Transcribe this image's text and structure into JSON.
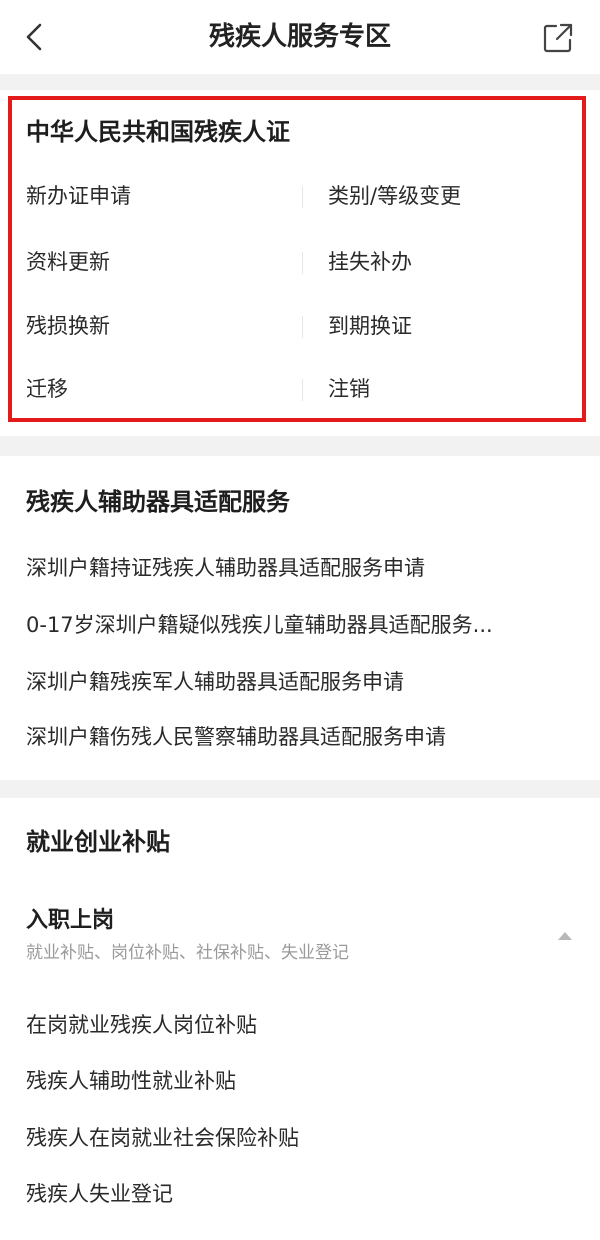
{
  "header": {
    "title": "残疾人服务专区",
    "back_icon": "back-chevron-icon",
    "share_icon": "share-external-icon"
  },
  "id_card": {
    "title": "中华人民共和国残疾人证",
    "items": [
      {
        "label": "新办证申请"
      },
      {
        "label": "类别/等级变更"
      },
      {
        "label": "资料更新"
      },
      {
        "label": "挂失补办"
      },
      {
        "label": "残损换新"
      },
      {
        "label": "到期换证"
      },
      {
        "label": "迁移"
      },
      {
        "label": "注销"
      }
    ]
  },
  "aids": {
    "title": "残疾人辅助器具适配服务",
    "items": [
      {
        "label": "深圳户籍持证残疾人辅助器具适配服务申请"
      },
      {
        "label": "0-17岁深圳户籍疑似残疾儿童辅助器具适配服务..."
      },
      {
        "label": "深圳户籍残疾军人辅助器具适配服务申请"
      },
      {
        "label": "深圳户籍伤残人民警察辅助器具适配服务申请"
      }
    ]
  },
  "employment": {
    "title": "就业创业补贴",
    "group": {
      "title": "入职上岗",
      "description": "就业补贴、岗位补贴、社保补贴、失业登记",
      "toggle_icon": "caret-up-icon",
      "items": [
        {
          "label": "在岗就业残疾人岗位补贴"
        },
        {
          "label": "残疾人辅助性就业补贴"
        },
        {
          "label": "残疾人在岗就业社会保险补贴"
        },
        {
          "label": "残疾人失业登记"
        }
      ]
    }
  },
  "colors": {
    "highlight": "#e41b1b",
    "background": "#f2f2f2",
    "text": "#222222",
    "muted": "#9a9a9a"
  }
}
